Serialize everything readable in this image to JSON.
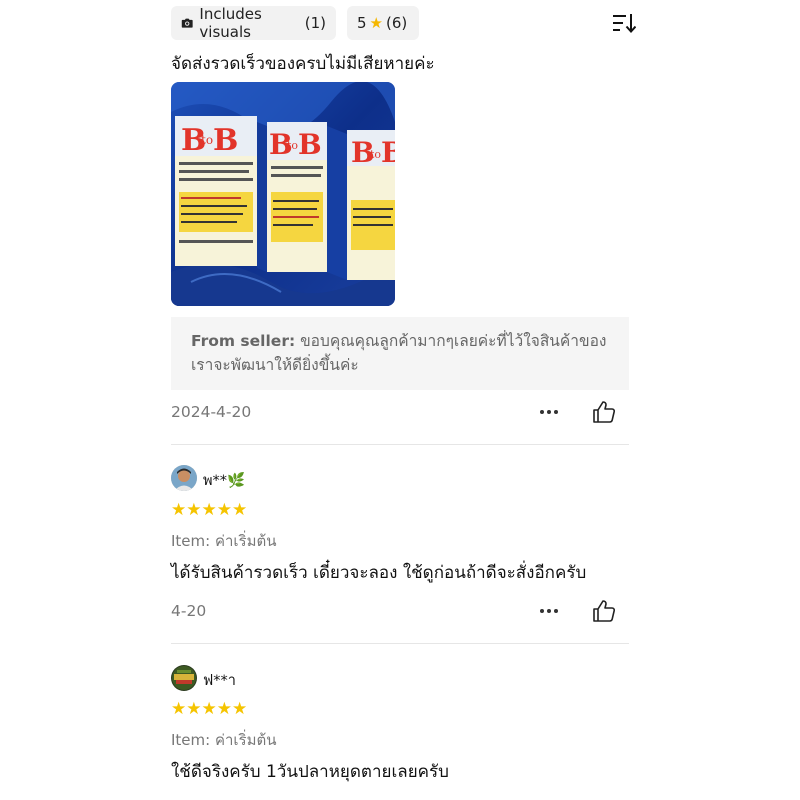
{
  "filters": {
    "visuals_label": "Includes visuals",
    "visuals_count": "(1)",
    "five_star_label": "5",
    "five_star_count": "(6)"
  },
  "review1": {
    "text": "จัดส่งรวดเร็วของครบไม่มีเสียหายค่ะ",
    "seller_prefix": "From seller:",
    "seller_reply": " ขอบคุณคุณลูกค้ามากๆเลยค่ะที่ไว้ใจสินค้าของเราจะพัฒนาให้ดียิ่งขึ้นค่ะ",
    "date": "2024-4-20"
  },
  "review2": {
    "username": "พ**",
    "user_emoji": "🌿",
    "rating": 5,
    "stars": "★★★★★",
    "item_label": "Item: ค่าเริ่มต้น",
    "text": "ได้รับสินค้ารวดเร็ว เดี๋ยวจะลอง ใช้ดูก่อนถ้าดีจะสั่งอีกครับ",
    "date": "4-20"
  },
  "review3": {
    "username": "ฟ**า",
    "rating": 5,
    "stars": "★★★★★",
    "item_label": "Item: ค่าเริ่มต้น",
    "text": "ใช้ดีจริงครับ 1วันปลาหยุดตายเลยครับ"
  },
  "photo_logo_text": "BtoB",
  "colors": {
    "star": "#f5c400",
    "chip_bg": "#f2f2f2",
    "seller_bg": "#f5f5f5"
  }
}
